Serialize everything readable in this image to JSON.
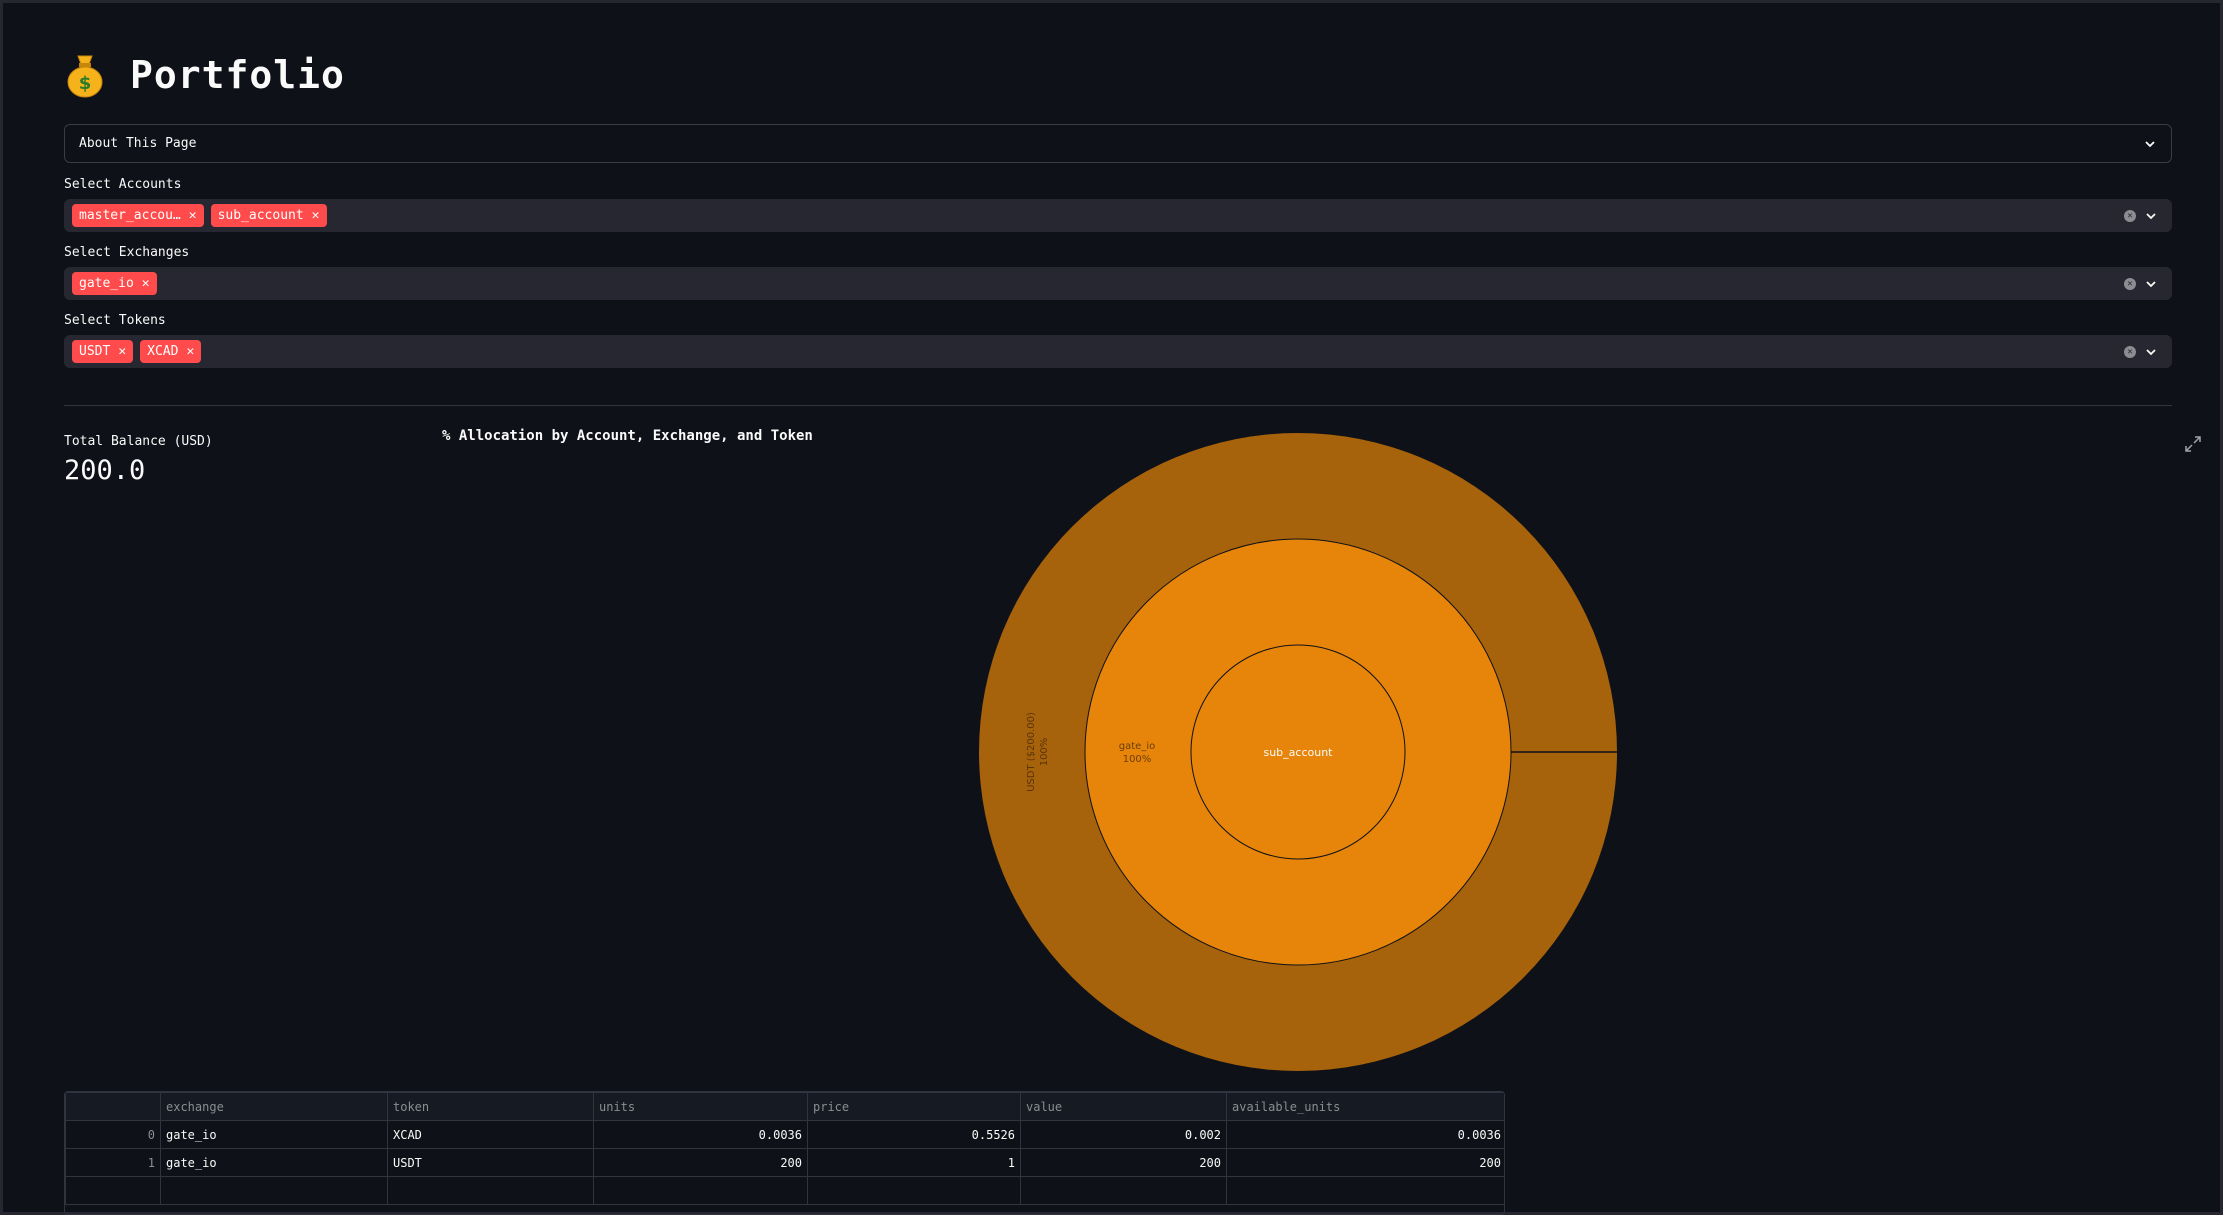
{
  "page": {
    "title": "Portfolio",
    "icon": "money-bag-icon"
  },
  "about_expander": {
    "label": "About This Page"
  },
  "filters": {
    "accounts": {
      "label": "Select Accounts",
      "selected": [
        "master_accou…",
        "sub_account"
      ]
    },
    "exchanges": {
      "label": "Select Exchanges",
      "selected": [
        "gate_io"
      ]
    },
    "tokens": {
      "label": "Select Tokens",
      "selected": [
        "USDT",
        "XCAD"
      ]
    }
  },
  "metric": {
    "label": "Total Balance (USD)",
    "value": "200.0"
  },
  "chart_data": {
    "type": "sunburst",
    "title": "% Allocation by Account, Exchange, and Token",
    "rings": [
      {
        "level": "account",
        "labels": [
          {
            "text": "sub_account",
            "share": 100
          }
        ],
        "color": "#e6850a"
      },
      {
        "level": "exchange",
        "labels": [
          {
            "text": "gate_io",
            "sub": "100%",
            "share": 100
          }
        ],
        "color": "#e6850a"
      },
      {
        "level": "token",
        "labels": [
          {
            "text": "USDT ($200.00)",
            "sub": "100%",
            "share": 100
          }
        ],
        "color": "#a7620c"
      }
    ]
  },
  "table": {
    "columns": [
      "",
      "exchange",
      "token",
      "units",
      "price",
      "value",
      "available_units"
    ],
    "rows": [
      {
        "index": "0",
        "exchange": "gate_io",
        "token": "XCAD",
        "units": "0.0036",
        "price": "0.5526",
        "value": "0.002",
        "available_units": "0.0036"
      },
      {
        "index": "1",
        "exchange": "gate_io",
        "token": "USDT",
        "units": "200",
        "price": "1",
        "value": "200",
        "available_units": "200"
      }
    ]
  }
}
